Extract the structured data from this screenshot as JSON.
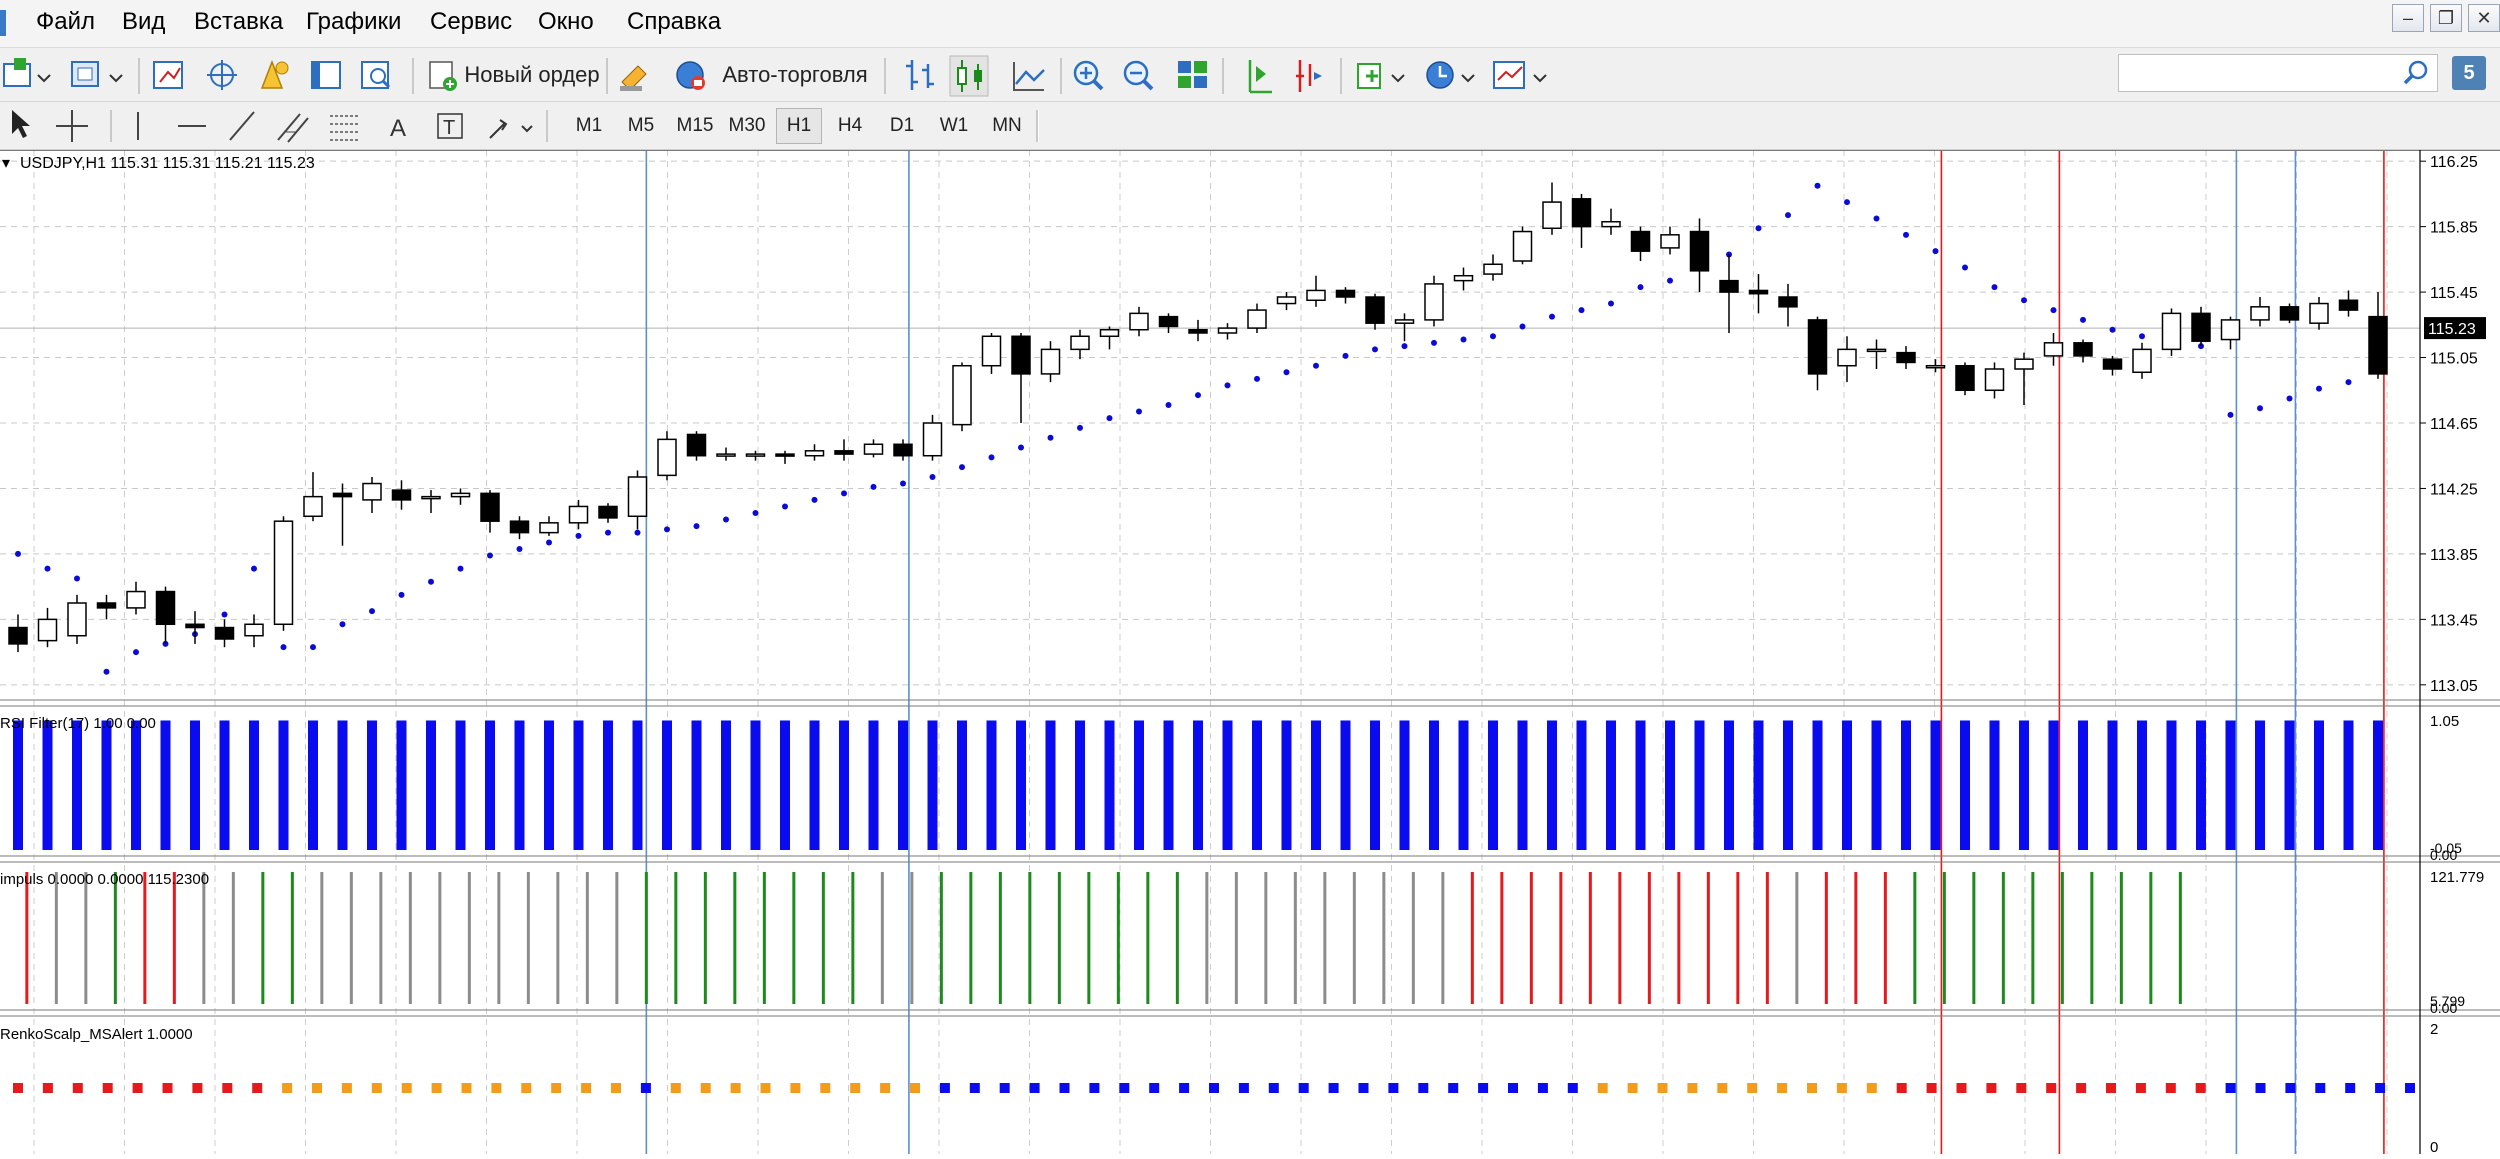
{
  "menu": {
    "items": [
      "Файл",
      "Вид",
      "Вставка",
      "Графики",
      "Сервис",
      "Окно",
      "Справка"
    ]
  },
  "toolbar": {
    "new_order_label": "Новый ордер",
    "auto_trading_label": "Авто-торговля",
    "timeframes": [
      "M1",
      "M5",
      "M15",
      "M30",
      "H1",
      "H4",
      "D1",
      "W1",
      "MN"
    ],
    "active_timeframe": "H1",
    "search_placeholder": "",
    "accent_color": "#1c5fb4"
  },
  "window": {
    "badge": "5"
  },
  "chart": {
    "symbol_label": "USDJPY,H1  115.31 115.31 115.21 115.23",
    "symbol": "USDJPY",
    "timeframe": "H1",
    "last_price": "115.23",
    "price_ticks": [
      "116.25",
      "115.85",
      "115.45",
      "115.05",
      "114.65",
      "114.25",
      "113.85",
      "113.45",
      "113.05"
    ]
  },
  "chart_data": {
    "type": "candlestick",
    "x": [
      1,
      2,
      3,
      4,
      5,
      6,
      7,
      8,
      9,
      10,
      11,
      12,
      13,
      14,
      15,
      16,
      17,
      18,
      19,
      20,
      21,
      22,
      23,
      24,
      25,
      26,
      27,
      28,
      29,
      30,
      31,
      32,
      33,
      34,
      35,
      36,
      37,
      38,
      39,
      40,
      41,
      42,
      43,
      44,
      45,
      46,
      47,
      48,
      49,
      50,
      51,
      52,
      53,
      54,
      55,
      56,
      57,
      58,
      59,
      60,
      61,
      62,
      63,
      64,
      65,
      66,
      67,
      68,
      69,
      70,
      71,
      72,
      73,
      74,
      75,
      76,
      77,
      78,
      79,
      80,
      81
    ],
    "ylim": [
      113.0,
      116.3
    ],
    "y_ticks": [
      113.05,
      113.45,
      113.85,
      114.25,
      114.65,
      115.05,
      115.45,
      115.85,
      116.25
    ],
    "candles": [
      [
        113.4,
        113.3,
        113.48,
        113.25
      ],
      [
        113.32,
        113.45,
        113.52,
        113.28
      ],
      [
        113.35,
        113.55,
        113.6,
        113.3
      ],
      [
        113.55,
        113.52,
        113.6,
        113.45
      ],
      [
        113.52,
        113.62,
        113.68,
        113.48
      ],
      [
        113.62,
        113.42,
        113.65,
        113.3
      ],
      [
        113.42,
        113.4,
        113.5,
        113.3
      ],
      [
        113.4,
        113.33,
        113.45,
        113.28
      ],
      [
        113.35,
        113.42,
        113.48,
        113.28
      ],
      [
        113.42,
        114.05,
        114.08,
        113.38
      ],
      [
        114.08,
        114.2,
        114.35,
        114.05
      ],
      [
        114.22,
        114.2,
        114.28,
        113.9
      ],
      [
        114.18,
        114.28,
        114.32,
        114.1
      ],
      [
        114.24,
        114.18,
        114.3,
        114.12
      ],
      [
        114.2,
        114.2,
        114.24,
        114.1
      ],
      [
        114.2,
        114.22,
        114.25,
        114.15
      ],
      [
        114.22,
        114.05,
        114.24,
        113.98
      ],
      [
        114.05,
        113.98,
        114.08,
        113.94
      ],
      [
        113.98,
        114.04,
        114.08,
        113.96
      ],
      [
        114.04,
        114.14,
        114.18,
        114.0
      ],
      [
        114.14,
        114.07,
        114.16,
        114.04
      ],
      [
        114.08,
        114.32,
        114.36,
        114.0
      ],
      [
        114.33,
        114.55,
        114.6,
        114.3
      ],
      [
        114.58,
        114.45,
        114.6,
        114.42
      ],
      [
        114.46,
        114.46,
        114.5,
        114.42
      ],
      [
        114.46,
        114.46,
        114.48,
        114.42
      ],
      [
        114.46,
        114.45,
        114.48,
        114.4
      ],
      [
        114.45,
        114.48,
        114.52,
        114.42
      ],
      [
        114.48,
        114.46,
        114.55,
        114.42
      ],
      [
        114.46,
        114.52,
        114.55,
        114.44
      ],
      [
        114.52,
        114.45,
        114.55,
        114.42
      ],
      [
        114.45,
        114.65,
        114.7,
        114.42
      ],
      [
        114.64,
        115.0,
        115.02,
        114.6
      ],
      [
        115.0,
        115.18,
        115.2,
        114.95
      ],
      [
        115.18,
        114.95,
        115.2,
        114.65
      ],
      [
        114.95,
        115.1,
        115.15,
        114.9
      ],
      [
        115.1,
        115.18,
        115.22,
        115.04
      ],
      [
        115.18,
        115.22,
        115.24,
        115.1
      ],
      [
        115.22,
        115.32,
        115.36,
        115.18
      ],
      [
        115.3,
        115.24,
        115.32,
        115.2
      ],
      [
        115.22,
        115.2,
        115.28,
        115.15
      ],
      [
        115.2,
        115.23,
        115.26,
        115.16
      ],
      [
        115.23,
        115.34,
        115.38,
        115.2
      ],
      [
        115.38,
        115.42,
        115.45,
        115.34
      ],
      [
        115.4,
        115.46,
        115.55,
        115.36
      ],
      [
        115.46,
        115.42,
        115.48,
        115.38
      ],
      [
        115.42,
        115.26,
        115.44,
        115.22
      ],
      [
        115.26,
        115.28,
        115.32,
        115.15
      ],
      [
        115.28,
        115.5,
        115.55,
        115.24
      ],
      [
        115.52,
        115.55,
        115.6,
        115.46
      ],
      [
        115.56,
        115.62,
        115.68,
        115.52
      ],
      [
        115.64,
        115.82,
        115.85,
        115.62
      ],
      [
        115.84,
        116.0,
        116.12,
        115.8
      ],
      [
        116.02,
        115.85,
        116.05,
        115.72
      ],
      [
        115.85,
        115.88,
        115.96,
        115.8
      ],
      [
        115.82,
        115.7,
        115.85,
        115.64
      ],
      [
        115.72,
        115.8,
        115.85,
        115.68
      ],
      [
        115.82,
        115.58,
        115.9,
        115.45
      ],
      [
        115.52,
        115.45,
        115.68,
        115.2
      ],
      [
        115.46,
        115.44,
        115.56,
        115.32
      ],
      [
        115.42,
        115.36,
        115.5,
        115.24
      ],
      [
        115.28,
        114.95,
        115.3,
        114.85
      ],
      [
        115.0,
        115.1,
        115.18,
        114.9
      ],
      [
        115.1,
        115.1,
        115.16,
        114.98
      ],
      [
        115.08,
        115.02,
        115.12,
        114.98
      ],
      [
        115.0,
        115.0,
        115.04,
        114.96
      ],
      [
        115.0,
        114.85,
        115.02,
        114.82
      ],
      [
        114.85,
        114.98,
        115.02,
        114.8
      ],
      [
        114.98,
        115.04,
        115.08,
        114.76
      ],
      [
        115.06,
        115.14,
        115.2,
        115.0
      ],
      [
        115.14,
        115.06,
        115.16,
        115.02
      ],
      [
        115.04,
        114.98,
        115.06,
        114.94
      ],
      [
        114.96,
        115.1,
        115.14,
        114.92
      ],
      [
        115.1,
        115.32,
        115.35,
        115.06
      ],
      [
        115.32,
        115.15,
        115.36,
        115.12
      ],
      [
        115.16,
        115.28,
        115.3,
        115.1
      ],
      [
        115.28,
        115.36,
        115.42,
        115.24
      ],
      [
        115.36,
        115.28,
        115.38,
        115.26
      ],
      [
        115.26,
        115.38,
        115.42,
        115.22
      ],
      [
        115.4,
        115.34,
        115.46,
        115.3
      ],
      [
        115.3,
        114.95,
        115.45,
        114.92
      ]
    ],
    "candle_format": [
      "open",
      "close",
      "high",
      "low"
    ],
    "series": [
      {
        "values": [
          113.85,
          113.76,
          113.7,
          113.13,
          113.25,
          113.3,
          113.36,
          113.48,
          113.76,
          113.28,
          113.28,
          113.42,
          113.5,
          113.6,
          113.68,
          113.76,
          113.84,
          113.88,
          113.92,
          113.96,
          113.98,
          113.98,
          114.0,
          114.02,
          114.06,
          114.1,
          114.14,
          114.18,
          114.22,
          114.26,
          114.28,
          114.32,
          114.38,
          114.44,
          114.5,
          114.56,
          114.62,
          114.68,
          114.72,
          114.76,
          114.82,
          114.88,
          114.92,
          114.96,
          115.0,
          115.06,
          115.1,
          115.12,
          115.14,
          115.16,
          115.18,
          115.24,
          115.3,
          115.34,
          115.38,
          115.48,
          115.52,
          115.62,
          115.68,
          115.84,
          115.92,
          116.1,
          116.0,
          115.9,
          115.8,
          115.7,
          115.6,
          115.48,
          115.4,
          115.34,
          115.28,
          115.22,
          115.18,
          115.16,
          115.12,
          114.7,
          114.74,
          114.8,
          114.86,
          114.9,
          115.0
        ]
      }
    ],
    "vlines": [
      {
        "x": 22.3,
        "color": "#5b8fd0"
      },
      {
        "x": 31.2,
        "color": "#5b8fd0"
      },
      {
        "x": 66.2,
        "color": "#e41a1c"
      },
      {
        "x": 70.2,
        "color": "#e41a1c"
      },
      {
        "x": 76.2,
        "color": "#5b8fd0"
      },
      {
        "x": 78.2,
        "color": "#5b8fd0"
      },
      {
        "x": 81.2,
        "color": "#e41a1c"
      }
    ]
  },
  "indicators": {
    "rsi": {
      "label": "RSI Filter(17) 1.00 0.00",
      "top_tick": "1.05",
      "bottom_ticks": [
        "-0.05",
        "0.00"
      ],
      "value": 1.0,
      "color": "#0b0bf0"
    },
    "impuls": {
      "label": "impuls 0.0000 0.0000 115.2300",
      "top_tick": "121.779",
      "bottom_ticks": [
        "5.799",
        "0.00"
      ],
      "colors": {
        "r": "#e41a1c",
        "g": "#1c8a1c",
        "x": "#8c8c8c"
      },
      "pattern": "rxxgrrxxggxxxxxxxxxxxggggggggxxgggggggggxxxxxxxxxrrrrrrrrrrrxrrrgggggggggg"
    },
    "renko": {
      "label": "RenkoScalp_MSAlert 1.0000",
      "top_tick": "2",
      "bottom_tick": "0",
      "colors": {
        "r": "#e41a1c",
        "o": "#f39c1c",
        "b": "#0b0bf0"
      },
      "pattern": "rrrrrrrrroooooooooooobooooooooobbbbbbbbbbbbbbbbbbbbbboooooooooorrrrrrrrrrrbbbbbbb"
    }
  }
}
